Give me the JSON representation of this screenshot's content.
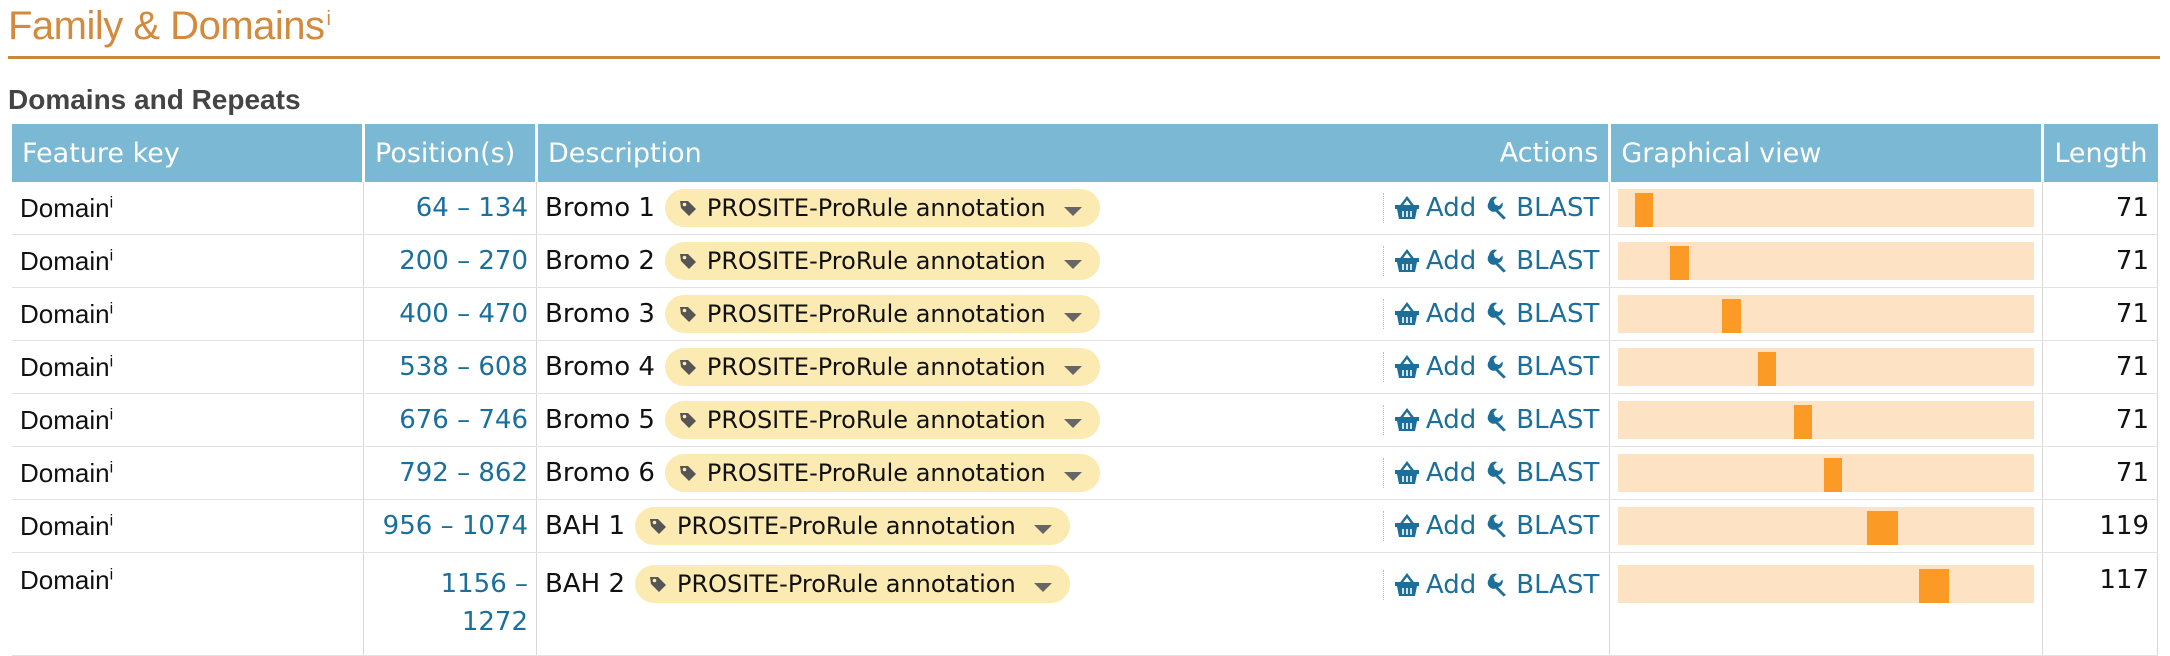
{
  "section": {
    "title": "Family & Domains",
    "info_marker": "i"
  },
  "subsection": {
    "title": "Domains and Repeats"
  },
  "table": {
    "headers": {
      "feature_key": "Feature key",
      "positions": "Position(s)",
      "description": "Description",
      "actions": "Actions",
      "graphical_view": "Graphical view",
      "length": "Length"
    },
    "protein_length": 1600,
    "rows": [
      {
        "key": "Domain",
        "info": "i",
        "start": 64,
        "end": 134,
        "range": "64 – 134",
        "description": "Bromo 1",
        "evidence": "PROSITE-ProRule annotation",
        "add": "Add",
        "blast": "BLAST",
        "length": "71"
      },
      {
        "key": "Domain",
        "info": "i",
        "start": 200,
        "end": 270,
        "range": "200 – 270",
        "description": "Bromo 2",
        "evidence": "PROSITE-ProRule annotation",
        "add": "Add",
        "blast": "BLAST",
        "length": "71"
      },
      {
        "key": "Domain",
        "info": "i",
        "start": 400,
        "end": 470,
        "range": "400 – 470",
        "description": "Bromo 3",
        "evidence": "PROSITE-ProRule annotation",
        "add": "Add",
        "blast": "BLAST",
        "length": "71"
      },
      {
        "key": "Domain",
        "info": "i",
        "start": 538,
        "end": 608,
        "range": "538 – 608",
        "description": "Bromo 4",
        "evidence": "PROSITE-ProRule annotation",
        "add": "Add",
        "blast": "BLAST",
        "length": "71"
      },
      {
        "key": "Domain",
        "info": "i",
        "start": 676,
        "end": 746,
        "range": "676 – 746",
        "description": "Bromo 5",
        "evidence": "PROSITE-ProRule annotation",
        "add": "Add",
        "blast": "BLAST",
        "length": "71"
      },
      {
        "key": "Domain",
        "info": "i",
        "start": 792,
        "end": 862,
        "range": "792 – 862",
        "description": "Bromo 6",
        "evidence": "PROSITE-ProRule annotation",
        "add": "Add",
        "blast": "BLAST",
        "length": "71"
      },
      {
        "key": "Domain",
        "info": "i",
        "start": 956,
        "end": 1074,
        "range": "956 – 1074",
        "description": "BAH 1",
        "evidence": "PROSITE-ProRule annotation",
        "add": "Add",
        "blast": "BLAST",
        "length": "119"
      },
      {
        "key": "Domain",
        "info": "i",
        "start": 1156,
        "end": 1272,
        "range": "1156 – 1272",
        "description": "BAH 2",
        "evidence": "PROSITE-ProRule annotation",
        "add": "Add",
        "blast": "BLAST",
        "length": "117"
      }
    ]
  },
  "colors": {
    "title": "#d38a3c",
    "rule": "#c8893a",
    "header_bg": "#7ab8d4",
    "link": "#1b6f9a",
    "pill": "#fbeab2",
    "track": "#fde3c4",
    "domain_mark": "#fb9b25"
  },
  "icons": {
    "evidence": "tag-icon",
    "add": "basket-icon",
    "blast": "wrench-icon",
    "dropdown": "caret-down-icon"
  }
}
